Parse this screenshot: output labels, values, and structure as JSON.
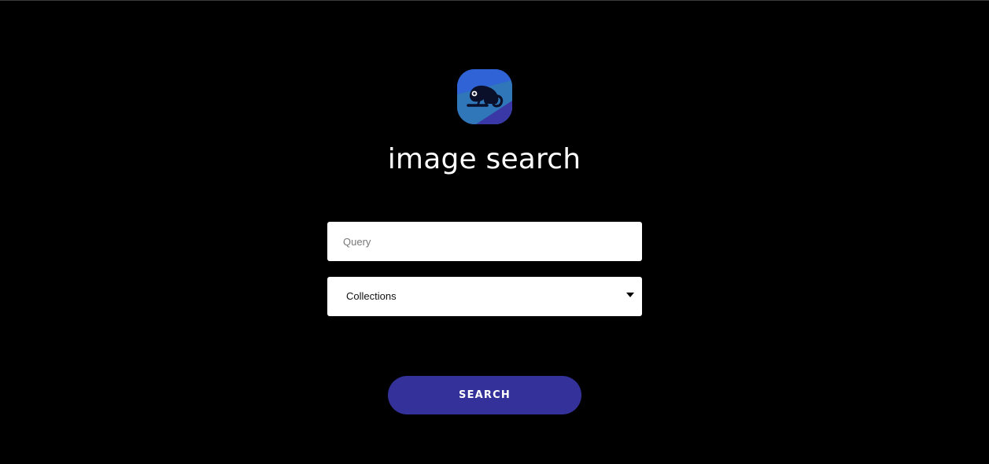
{
  "app": {
    "title": "image search",
    "logo_icon": "chameleon-icon",
    "logo_colors": [
      "#2f63d6",
      "#2f7fb0",
      "#3a3aa8"
    ]
  },
  "search": {
    "query_placeholder": "Query",
    "query_value": "",
    "collections_selected": "Collections",
    "button_label": "SEARCH",
    "button_color": "#34329a"
  },
  "theme": {
    "background": "#000000"
  }
}
